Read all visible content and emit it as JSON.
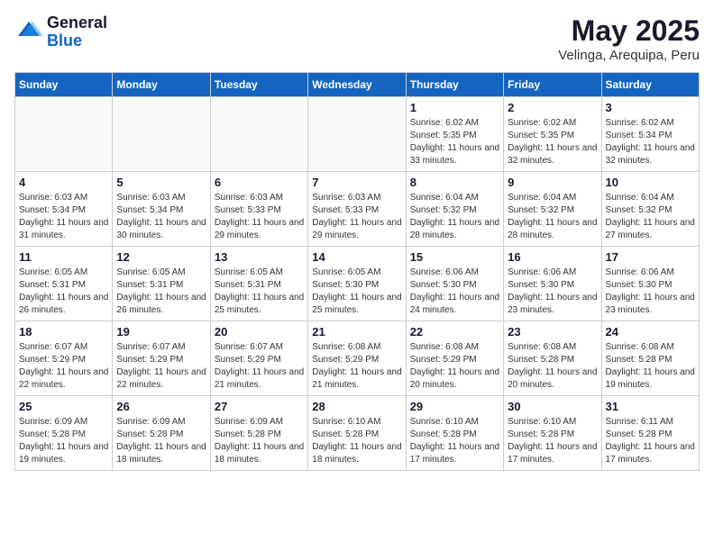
{
  "header": {
    "logo_general": "General",
    "logo_blue": "Blue",
    "month_year": "May 2025",
    "location": "Velinga, Arequipa, Peru"
  },
  "days_of_week": [
    "Sunday",
    "Monday",
    "Tuesday",
    "Wednesday",
    "Thursday",
    "Friday",
    "Saturday"
  ],
  "weeks": [
    [
      {
        "day": "",
        "info": ""
      },
      {
        "day": "",
        "info": ""
      },
      {
        "day": "",
        "info": ""
      },
      {
        "day": "",
        "info": ""
      },
      {
        "day": "1",
        "info": "Sunrise: 6:02 AM\nSunset: 5:35 PM\nDaylight: 11 hours and 33 minutes."
      },
      {
        "day": "2",
        "info": "Sunrise: 6:02 AM\nSunset: 5:35 PM\nDaylight: 11 hours and 32 minutes."
      },
      {
        "day": "3",
        "info": "Sunrise: 6:02 AM\nSunset: 5:34 PM\nDaylight: 11 hours and 32 minutes."
      }
    ],
    [
      {
        "day": "4",
        "info": "Sunrise: 6:03 AM\nSunset: 5:34 PM\nDaylight: 11 hours and 31 minutes."
      },
      {
        "day": "5",
        "info": "Sunrise: 6:03 AM\nSunset: 5:34 PM\nDaylight: 11 hours and 30 minutes."
      },
      {
        "day": "6",
        "info": "Sunrise: 6:03 AM\nSunset: 5:33 PM\nDaylight: 11 hours and 29 minutes."
      },
      {
        "day": "7",
        "info": "Sunrise: 6:03 AM\nSunset: 5:33 PM\nDaylight: 11 hours and 29 minutes."
      },
      {
        "day": "8",
        "info": "Sunrise: 6:04 AM\nSunset: 5:32 PM\nDaylight: 11 hours and 28 minutes."
      },
      {
        "day": "9",
        "info": "Sunrise: 6:04 AM\nSunset: 5:32 PM\nDaylight: 11 hours and 28 minutes."
      },
      {
        "day": "10",
        "info": "Sunrise: 6:04 AM\nSunset: 5:32 PM\nDaylight: 11 hours and 27 minutes."
      }
    ],
    [
      {
        "day": "11",
        "info": "Sunrise: 6:05 AM\nSunset: 5:31 PM\nDaylight: 11 hours and 26 minutes."
      },
      {
        "day": "12",
        "info": "Sunrise: 6:05 AM\nSunset: 5:31 PM\nDaylight: 11 hours and 26 minutes."
      },
      {
        "day": "13",
        "info": "Sunrise: 6:05 AM\nSunset: 5:31 PM\nDaylight: 11 hours and 25 minutes."
      },
      {
        "day": "14",
        "info": "Sunrise: 6:05 AM\nSunset: 5:30 PM\nDaylight: 11 hours and 25 minutes."
      },
      {
        "day": "15",
        "info": "Sunrise: 6:06 AM\nSunset: 5:30 PM\nDaylight: 11 hours and 24 minutes."
      },
      {
        "day": "16",
        "info": "Sunrise: 6:06 AM\nSunset: 5:30 PM\nDaylight: 11 hours and 23 minutes."
      },
      {
        "day": "17",
        "info": "Sunrise: 6:06 AM\nSunset: 5:30 PM\nDaylight: 11 hours and 23 minutes."
      }
    ],
    [
      {
        "day": "18",
        "info": "Sunrise: 6:07 AM\nSunset: 5:29 PM\nDaylight: 11 hours and 22 minutes."
      },
      {
        "day": "19",
        "info": "Sunrise: 6:07 AM\nSunset: 5:29 PM\nDaylight: 11 hours and 22 minutes."
      },
      {
        "day": "20",
        "info": "Sunrise: 6:07 AM\nSunset: 5:29 PM\nDaylight: 11 hours and 21 minutes."
      },
      {
        "day": "21",
        "info": "Sunrise: 6:08 AM\nSunset: 5:29 PM\nDaylight: 11 hours and 21 minutes."
      },
      {
        "day": "22",
        "info": "Sunrise: 6:08 AM\nSunset: 5:29 PM\nDaylight: 11 hours and 20 minutes."
      },
      {
        "day": "23",
        "info": "Sunrise: 6:08 AM\nSunset: 5:28 PM\nDaylight: 11 hours and 20 minutes."
      },
      {
        "day": "24",
        "info": "Sunrise: 6:08 AM\nSunset: 5:28 PM\nDaylight: 11 hours and 19 minutes."
      }
    ],
    [
      {
        "day": "25",
        "info": "Sunrise: 6:09 AM\nSunset: 5:28 PM\nDaylight: 11 hours and 19 minutes."
      },
      {
        "day": "26",
        "info": "Sunrise: 6:09 AM\nSunset: 5:28 PM\nDaylight: 11 hours and 18 minutes."
      },
      {
        "day": "27",
        "info": "Sunrise: 6:09 AM\nSunset: 5:28 PM\nDaylight: 11 hours and 18 minutes."
      },
      {
        "day": "28",
        "info": "Sunrise: 6:10 AM\nSunset: 5:28 PM\nDaylight: 11 hours and 18 minutes."
      },
      {
        "day": "29",
        "info": "Sunrise: 6:10 AM\nSunset: 5:28 PM\nDaylight: 11 hours and 17 minutes."
      },
      {
        "day": "30",
        "info": "Sunrise: 6:10 AM\nSunset: 5:28 PM\nDaylight: 11 hours and 17 minutes."
      },
      {
        "day": "31",
        "info": "Sunrise: 6:11 AM\nSunset: 5:28 PM\nDaylight: 11 hours and 17 minutes."
      }
    ]
  ]
}
